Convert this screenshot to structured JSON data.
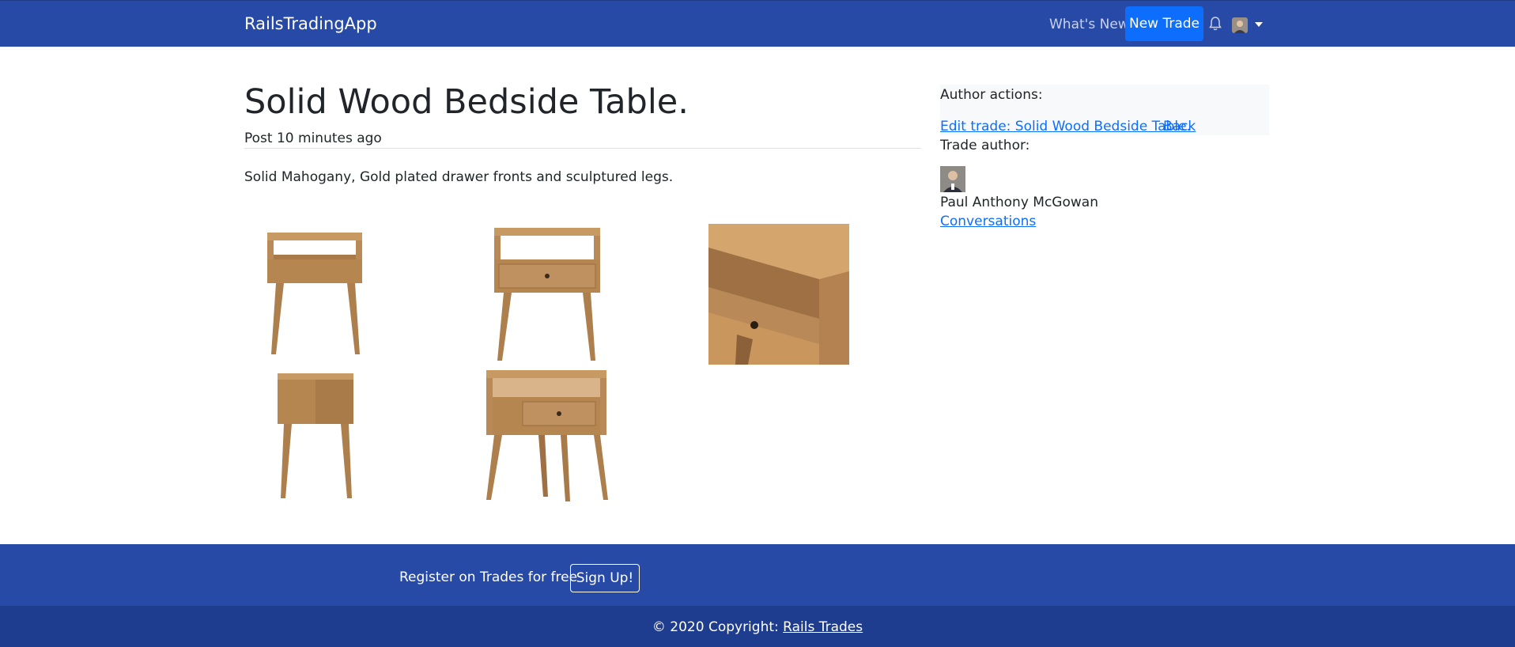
{
  "navbar": {
    "brand": "RailsTradingApp",
    "whats_new": "What's New",
    "new_trade": "New Trade"
  },
  "trade": {
    "title": "Solid Wood Bedside Table.",
    "posted": "Post 10 minutes ago",
    "description": "Solid Mahogany, Gold plated drawer fronts and sculptured legs."
  },
  "sidebar": {
    "author_actions": "Author actions:",
    "edit_link": "Edit trade: Solid Wood Bedside Table.",
    "back_link": "Back",
    "trade_author": "Trade author:",
    "author_name": "Paul Anthony McGowan",
    "conversations": "Conversations"
  },
  "footer": {
    "register_text": "Register on Trades for free",
    "signup": "Sign Up!",
    "copyright_prefix": "© 2020 Copyright:",
    "copyright_link": "Rails Trades"
  },
  "colors": {
    "navbar": "#274aa7",
    "accent": "#0d6efd",
    "wood": "#b98a57"
  }
}
